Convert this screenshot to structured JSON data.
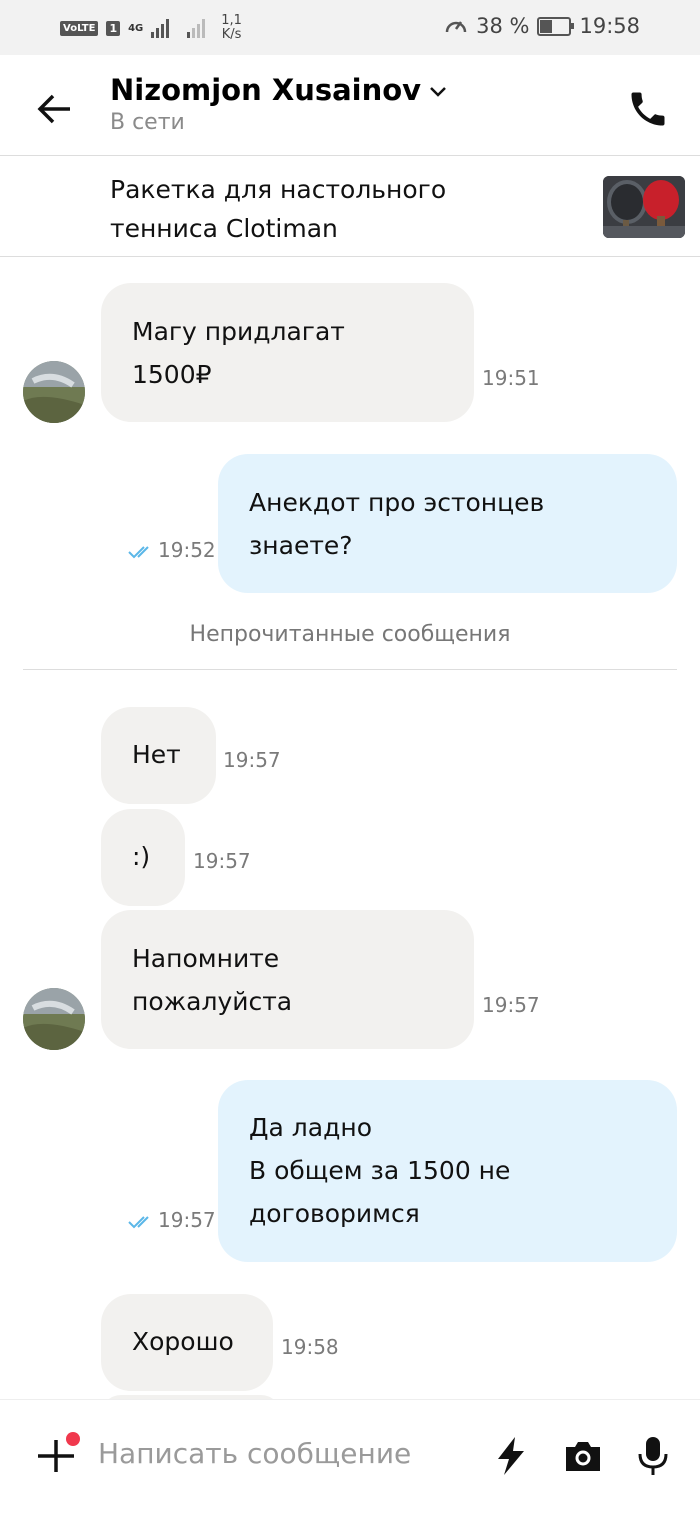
{
  "status_bar": {
    "volte": "VoLTE",
    "sim": "1",
    "network": "4G",
    "speed_value": "1,1",
    "speed_unit": "K/s",
    "battery": "38 %",
    "battery_level": 0.38,
    "time": "19:58"
  },
  "header": {
    "name": "Nizomjon Xusainov",
    "status": "В сети"
  },
  "product": {
    "title": "Ракетка для настольного тенниса Clotiman"
  },
  "messages": [
    {
      "text": "Магу придлагат\n1500₽",
      "time": "19:51"
    },
    {
      "text": "Анекдот про эстонцев\nзнаете?",
      "time": "19:52"
    },
    {
      "text": "Нет",
      "time": "19:57"
    },
    {
      "text": ":)",
      "time": "19:57"
    },
    {
      "text": "Напомните\nпожалуйста",
      "time": "19:57"
    },
    {
      "text": "Да ладно\nВ общем за 1500 не\nдоговоримся",
      "time": "19:57"
    },
    {
      "text": "Хорошо",
      "time": "19:58"
    }
  ],
  "unread_label": "Непрочитанные сообщения",
  "composer": {
    "placeholder": "Написать сообщение"
  },
  "colors": {
    "incoming_bubble": "#f2f1ef",
    "outgoing_bubble": "#e3f3fd",
    "read_ticks": "#5bb7e8",
    "notification_dot": "#f0384d"
  }
}
